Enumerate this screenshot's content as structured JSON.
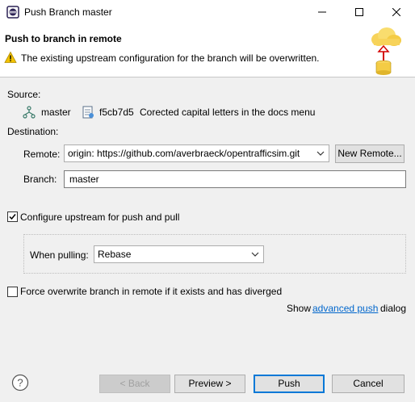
{
  "window": {
    "title": "Push Branch master",
    "icon": "eclipse-icon"
  },
  "banner": {
    "title": "Push to branch in remote",
    "message": "The existing upstream configuration for the branch will be overwritten.",
    "icon": "push-to-cloud-icon"
  },
  "source": {
    "label": "Source:",
    "branch": "master",
    "commit_id": "f5cb7d5",
    "commit_message": "Corected capital letters in the docs menu"
  },
  "destination": {
    "label": "Destination:",
    "remote_label": "Remote:",
    "remote_value": "origin: https://github.com/averbraeck/opentrafficsim.git",
    "new_remote_label": "New Remote...",
    "branch_label": "Branch:",
    "branch_value": "master"
  },
  "upstream": {
    "checkbox_label": "Configure upstream for push and pull",
    "checked": true,
    "when_pulling_label": "When pulling:",
    "when_pulling_value": "Rebase"
  },
  "force": {
    "checkbox_label": "Force overwrite branch in remote if it exists and has diverged",
    "checked": false
  },
  "advanced": {
    "prefix": "Show",
    "link": "advanced push",
    "suffix": "dialog"
  },
  "footer": {
    "back_label": "< Back",
    "preview_label": "Preview >",
    "push_label": "Push",
    "cancel_label": "Cancel"
  },
  "colors": {
    "accent": "#0078d7",
    "link": "#0066cc",
    "warning": "#f2c200"
  }
}
